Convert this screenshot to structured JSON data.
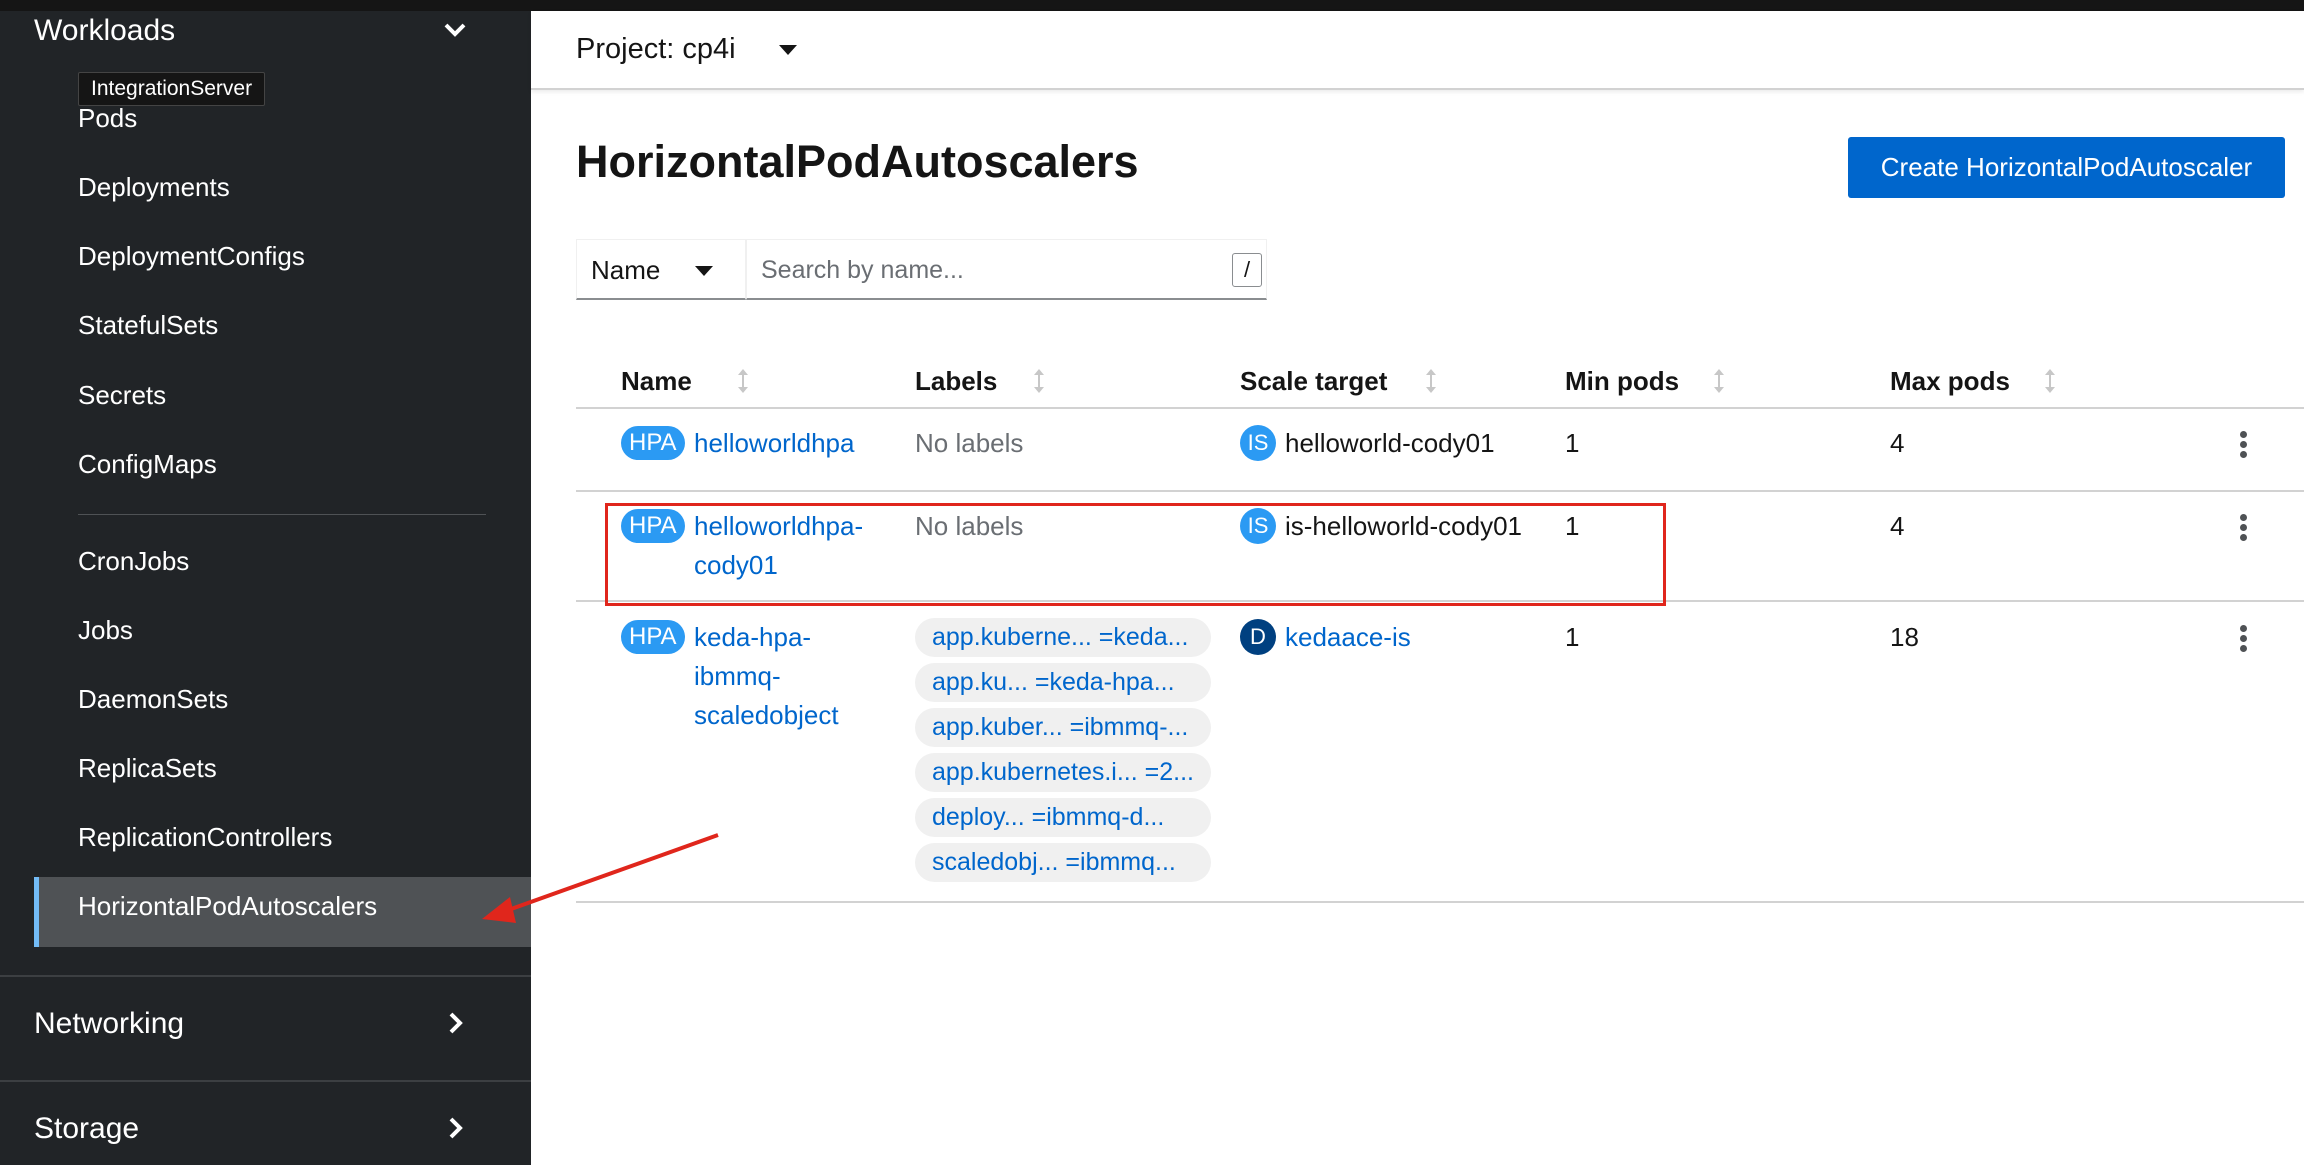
{
  "sidebar": {
    "workloads_label": "Workloads",
    "tooltip": "IntegrationServer",
    "items": [
      {
        "label": "Pods"
      },
      {
        "label": "Deployments"
      },
      {
        "label": "DeploymentConfigs"
      },
      {
        "label": "StatefulSets"
      },
      {
        "label": "Secrets"
      },
      {
        "label": "ConfigMaps"
      },
      {
        "label": "CronJobs"
      },
      {
        "label": "Jobs"
      },
      {
        "label": "DaemonSets"
      },
      {
        "label": "ReplicaSets"
      },
      {
        "label": "ReplicationControllers"
      },
      {
        "label": "HorizontalPodAutoscalers"
      }
    ],
    "networking_label": "Networking",
    "storage_label": "Storage"
  },
  "project": {
    "label": "Project: cp4i"
  },
  "page": {
    "title": "HorizontalPodAutoscalers",
    "create_label": "Create HorizontalPodAutoscaler"
  },
  "filter": {
    "selected": "Name",
    "placeholder": "Search by name...",
    "shortcut": "/"
  },
  "table": {
    "headers": [
      "Name",
      "Labels",
      "Scale target",
      "Min pods",
      "Max pods"
    ],
    "rows": [
      {
        "badge": "HPA",
        "name_lines": [
          "helloworldhpa"
        ],
        "labels_text": "No labels",
        "target_badge": "IS",
        "target": "helloworld-cody01",
        "min": "1",
        "max": "4"
      },
      {
        "badge": "HPA",
        "name_lines": [
          "helloworldhpa-",
          "cody01"
        ],
        "labels_text": "No labels",
        "target_badge": "IS",
        "target": "is-helloworld-cody01",
        "min": "1",
        "max": "4"
      },
      {
        "badge": "HPA",
        "name_lines": [
          "keda-hpa-",
          "ibmmq-",
          "scaledobject"
        ],
        "labels": [
          "app.kuberne...  =keda...",
          "app.ku...   =keda-hpa...",
          "app.kuber... =ibmmq-...",
          "app.kubernetes.i... =2...",
          "deploy...    =ibmmq-d...",
          "scaledobj...   =ibmmq..."
        ],
        "target_badge": "D",
        "target": "kedaace-is",
        "min": "1",
        "max": "18"
      }
    ]
  },
  "colors": {
    "accent": "#0066cc",
    "badge": "#2b9af3",
    "annotation": "#e0261c",
    "sidebar_bg": "#212427"
  }
}
